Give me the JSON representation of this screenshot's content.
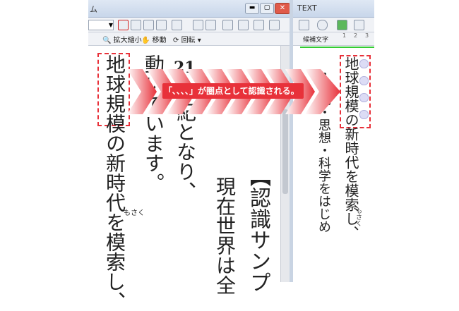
{
  "left_window": {
    "title_fragment": "ム",
    "toolbar": {
      "zoom_label": "拡大縮小",
      "move_label": "移動",
      "rotate_label": "回転"
    },
    "content": {
      "col1": "地球規模の新時代を模索し、",
      "col1_ruby": "もさく",
      "col2": "動いています。",
      "col3_top": "21",
      "col3": "紀となり、",
      "col4": "現在世界は全",
      "col5": "【認識サンプ"
    }
  },
  "right_window": {
    "title": "TEXT",
    "candidate_label": "候補文字",
    "ruler_marks": [
      "1",
      "2",
      "3"
    ],
    "content": {
      "col1": "地球規模の新時代を模索し、",
      "col1_ruby": "もさく",
      "col2": "・文化・思想・科学をはじめ"
    }
  },
  "callout": {
    "text": "「､､､､」が圏点として認識される。"
  },
  "colors": {
    "arrow": "#e8313a",
    "highlight_border": "#e8313a",
    "titlebar": "#c8d6ea",
    "close_button": "#e05a4a"
  }
}
